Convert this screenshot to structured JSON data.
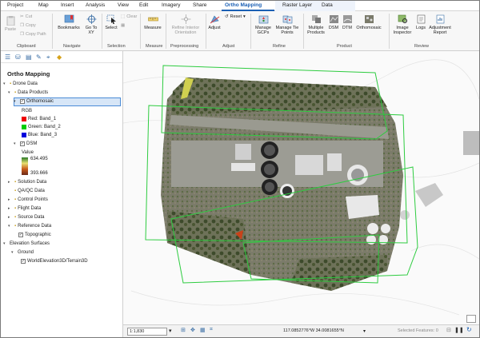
{
  "tabs": [
    "Project",
    "Map",
    "Insert",
    "Analysis",
    "View",
    "Edit",
    "Imagery",
    "Share",
    "Ortho Mapping",
    "Raster Layer",
    "Data"
  ],
  "active_tab": "Ortho Mapping",
  "ribbon": {
    "clipboard": {
      "paste": "Paste",
      "cut": "Cut",
      "copy": "Copy",
      "copy_path": "Copy Path",
      "label": "Clipboard"
    },
    "navigate": {
      "bookmarks": "Bookmarks",
      "go_to_xy": "Go To XY",
      "label": "Navigate"
    },
    "selection": {
      "select": "Select",
      "clear": "Clear",
      "label": "Selection"
    },
    "measure": {
      "measure": "Measure",
      "label": "Measure"
    },
    "preprocessing": {
      "refine": "Refine Interior Orientation",
      "label": "Preprocessing"
    },
    "adjust": {
      "adjust": "Adjust",
      "reset": "Reset",
      "label": "Adjust"
    },
    "refine": {
      "manage_gcps": "Manage GCPs",
      "manage_tie": "Manage Tie Points",
      "label": "Refine"
    },
    "product": {
      "multiple": "Multiple Products",
      "dsm": "DSM",
      "dtm": "DTM",
      "ortho": "Orthomosaic",
      "label": "Product"
    },
    "review": {
      "image_inspector": "Image Inspector",
      "logs": "Logs",
      "adj_report": "Adjustment Report",
      "label": "Review"
    }
  },
  "panel": {
    "title": "Ortho Mapping",
    "tree": [
      {
        "label": "Drone Data"
      },
      {
        "label": "Data Products"
      },
      {
        "label": "Orthomosaic"
      },
      {
        "label": "RGB"
      },
      {
        "label": "Red:  Band_1"
      },
      {
        "label": "Green: Band_2"
      },
      {
        "label": "Blue:  Band_3"
      },
      {
        "label": "DSM"
      },
      {
        "label": "Value"
      },
      {
        "label": "634.495"
      },
      {
        "label": "393.666"
      },
      {
        "label": "Solution Data"
      },
      {
        "label": "QA/QC Data"
      },
      {
        "label": "Control Points"
      },
      {
        "label": "Flight Data"
      },
      {
        "label": "Source Data"
      },
      {
        "label": "Reference Data"
      },
      {
        "label": "Topographic"
      },
      {
        "label": "Elevation Surfaces"
      },
      {
        "label": "Ground"
      },
      {
        "label": "WorldElevation3D/Terrain3D"
      }
    ]
  },
  "status": {
    "scale": "1:1,830",
    "coords": "117.0852776°W 34.0081655°N",
    "selected": "Selected Features: 0"
  },
  "colors": {
    "accent": "#1a5fb4",
    "footprint": "#2ecc40",
    "selection": "#d7e6f7"
  }
}
